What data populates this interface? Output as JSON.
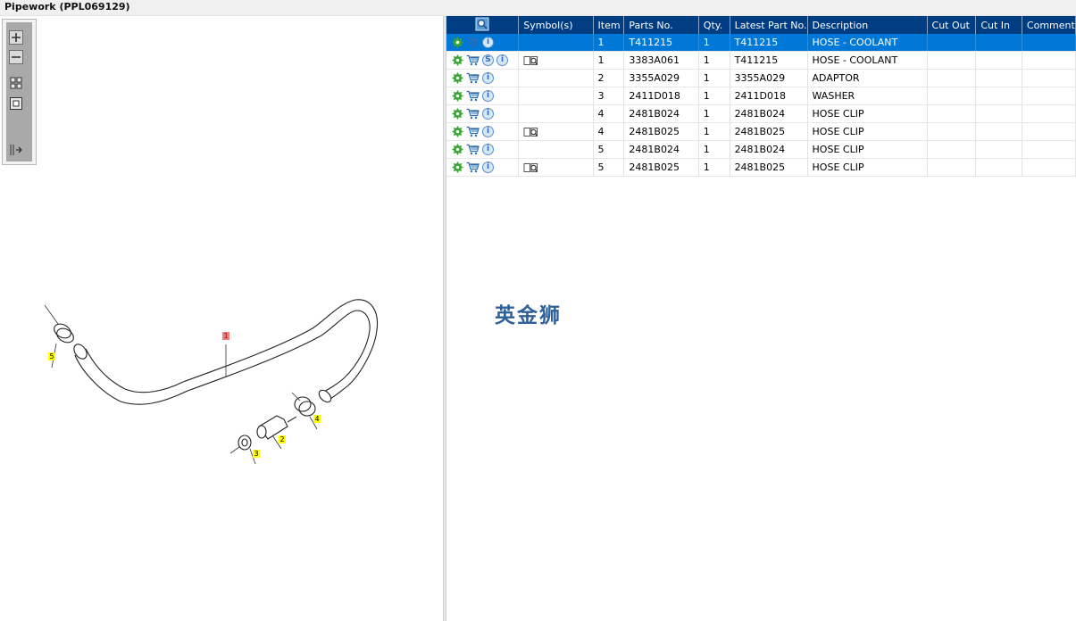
{
  "window": {
    "title": "Pipework (PPL069129)"
  },
  "toolbox": {
    "tools": [
      {
        "name": "zoom-in-tool"
      },
      {
        "name": "zoom-out-tool"
      },
      {
        "name": "fit-all-tool"
      },
      {
        "name": "fit-window-tool"
      },
      {
        "name": "export-tool"
      }
    ]
  },
  "diagram": {
    "callouts": [
      "1",
      "2",
      "3",
      "4",
      "5"
    ]
  },
  "table": {
    "columns": [
      "",
      "Symbol(s)",
      "Item",
      "Parts No.",
      "Qty.",
      "Latest Part No.",
      "Description",
      "Cut Out",
      "Cut In",
      "Comment"
    ],
    "rows": [
      {
        "item": "1",
        "part_no": "T411215",
        "qty": "1",
        "latest": "T411215",
        "desc": "HOSE - COOLANT",
        "cut_out": "",
        "cut_in": "",
        "comment": "",
        "icons": [
          "gear-icon",
          "cart-icon",
          "info-icon"
        ],
        "symbol": ""
      },
      {
        "item": "1",
        "part_no": "3383A061",
        "qty": "1",
        "latest": "T411215",
        "desc": "HOSE - COOLANT",
        "cut_out": "",
        "cut_in": "",
        "comment": "",
        "icons": [
          "gear-icon",
          "cart-icon",
          "s-icon",
          "info-icon"
        ],
        "symbol": "book-icon"
      },
      {
        "item": "2",
        "part_no": "3355A029",
        "qty": "1",
        "latest": "3355A029",
        "desc": "ADAPTOR",
        "cut_out": "",
        "cut_in": "",
        "comment": "",
        "icons": [
          "gear-icon",
          "cart-icon",
          "info-icon"
        ],
        "symbol": ""
      },
      {
        "item": "3",
        "part_no": "2411D018",
        "qty": "1",
        "latest": "2411D018",
        "desc": "WASHER",
        "cut_out": "",
        "cut_in": "",
        "comment": "",
        "icons": [
          "gear-icon",
          "cart-icon",
          "info-icon"
        ],
        "symbol": ""
      },
      {
        "item": "4",
        "part_no": "2481B024",
        "qty": "1",
        "latest": "2481B024",
        "desc": "HOSE CLIP",
        "cut_out": "",
        "cut_in": "",
        "comment": "",
        "icons": [
          "gear-icon",
          "cart-icon",
          "info-icon"
        ],
        "symbol": ""
      },
      {
        "item": "4",
        "part_no": "2481B025",
        "qty": "1",
        "latest": "2481B025",
        "desc": "HOSE CLIP",
        "cut_out": "",
        "cut_in": "",
        "comment": "",
        "icons": [
          "gear-icon",
          "cart-icon",
          "info-icon"
        ],
        "symbol": "book-icon"
      },
      {
        "item": "5",
        "part_no": "2481B024",
        "qty": "1",
        "latest": "2481B024",
        "desc": "HOSE CLIP",
        "cut_out": "",
        "cut_in": "",
        "comment": "",
        "icons": [
          "gear-icon",
          "cart-icon",
          "info-icon"
        ],
        "symbol": ""
      },
      {
        "item": "5",
        "part_no": "2481B025",
        "qty": "1",
        "latest": "2481B025",
        "desc": "HOSE CLIP",
        "cut_out": "",
        "cut_in": "",
        "comment": "",
        "icons": [
          "gear-icon",
          "cart-icon",
          "info-icon"
        ],
        "symbol": "book-icon"
      }
    ],
    "selected_row": 0
  },
  "watermark": "英金狮",
  "colors": {
    "header": "#003d83",
    "selected": "#0078d7",
    "gear": "#3aa335",
    "cart": "#2e6db3"
  }
}
